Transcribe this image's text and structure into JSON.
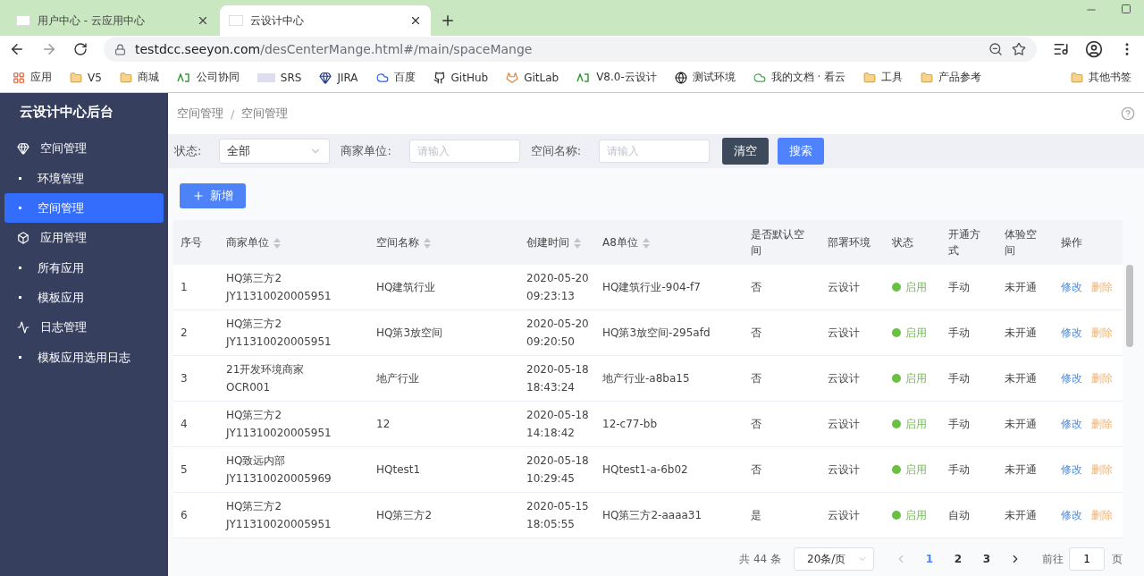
{
  "browser": {
    "tabs": [
      {
        "title": "用户中心 - 云应用中心",
        "selected": false
      },
      {
        "title": "云设计中心",
        "selected": true
      }
    ],
    "url": {
      "host": "testdcc.seeyon.com",
      "path": "/desCenterMange.html#/main/spaceMange"
    },
    "bookmarks": [
      "应用",
      "V5",
      "商城",
      "公司协同",
      "SRS",
      "JIRA",
      "百度",
      "GitHub",
      "GitLab",
      "V8.0-云设计",
      "测试环境",
      "我的文档 · 看云",
      "工具",
      "产品参考"
    ],
    "other_bookmarks": "其他书签"
  },
  "sidebar": {
    "title": "云设计中心后台",
    "sections": [
      {
        "label": "空间管理",
        "children": [
          {
            "label": "环境管理",
            "selected": false
          },
          {
            "label": "空间管理",
            "selected": true
          }
        ]
      },
      {
        "label": "应用管理",
        "children": [
          {
            "label": "所有应用",
            "selected": false
          },
          {
            "label": "模板应用",
            "selected": false
          }
        ]
      },
      {
        "label": "日志管理",
        "children": [
          {
            "label": "模板应用选用日志",
            "selected": false
          }
        ]
      }
    ]
  },
  "breadcrumb": {
    "items": [
      "空间管理",
      "空间管理"
    ],
    "separator": "/"
  },
  "filters": {
    "status": {
      "label": "状态:",
      "value": "全部"
    },
    "merchant": {
      "label": "商家单位:",
      "placeholder": "请输入"
    },
    "space_name": {
      "label": "空间名称:",
      "placeholder": "请输入"
    },
    "clear_button": "清空",
    "search_button": "搜索"
  },
  "add_button": "新增",
  "table": {
    "columns": [
      {
        "label": "序号",
        "sortable": false
      },
      {
        "label": "商家单位",
        "sortable": true
      },
      {
        "label": "空间名称",
        "sortable": true
      },
      {
        "label": "创建时间",
        "sortable": true
      },
      {
        "label": "A8单位",
        "sortable": true
      },
      {
        "label": "是否默认空间",
        "sortable": false
      },
      {
        "label": "部署环境",
        "sortable": false
      },
      {
        "label": "状态",
        "sortable": false
      },
      {
        "label": "开通方式",
        "sortable": false
      },
      {
        "label": "体验空间",
        "sortable": false
      },
      {
        "label": "操作",
        "sortable": false
      }
    ],
    "rows": [
      {
        "no": "1",
        "merchant": [
          "HQ第三方2",
          "JY11310020005951"
        ],
        "space": "HQ建筑行业",
        "created": [
          "2020-05-20",
          "09:23:13"
        ],
        "a8": "HQ建筑行业-904-f7",
        "default": "否",
        "env": "云设计",
        "status": {
          "text": "启用",
          "enabled": true
        },
        "open_mode": "手动",
        "trial": "未开通",
        "actions": [
          "修改",
          "删除"
        ]
      },
      {
        "no": "2",
        "merchant": [
          "HQ第三方2",
          "JY11310020005951"
        ],
        "space": "HQ第3放空间",
        "created": [
          "2020-05-20",
          "09:20:50"
        ],
        "a8": "HQ第3放空间-295afd",
        "default": "否",
        "env": "云设计",
        "status": {
          "text": "启用",
          "enabled": true
        },
        "open_mode": "手动",
        "trial": "未开通",
        "actions": [
          "修改",
          "删除"
        ]
      },
      {
        "no": "3",
        "merchant": [
          "21开发环境商家",
          "OCR001"
        ],
        "space": "地产行业",
        "created": [
          "2020-05-18",
          "18:43:24"
        ],
        "a8": "地产行业-a8ba15",
        "default": "否",
        "env": "云设计",
        "status": {
          "text": "启用",
          "enabled": true
        },
        "open_mode": "手动",
        "trial": "未开通",
        "actions": [
          "修改",
          "删除"
        ]
      },
      {
        "no": "4",
        "merchant": [
          "HQ第三方2",
          "JY11310020005951"
        ],
        "space": "12",
        "created": [
          "2020-05-18",
          "14:18:42"
        ],
        "a8": "12-c77-bb",
        "default": "否",
        "env": "云设计",
        "status": {
          "text": "启用",
          "enabled": true
        },
        "open_mode": "手动",
        "trial": "未开通",
        "actions": [
          "修改",
          "删除"
        ]
      },
      {
        "no": "5",
        "merchant": [
          "HQ致远内部",
          "JY11310020005969"
        ],
        "space": "HQtest1",
        "created": [
          "2020-05-18",
          "10:29:45"
        ],
        "a8": "HQtest1-a-6b02",
        "default": "否",
        "env": "云设计",
        "status": {
          "text": "启用",
          "enabled": true
        },
        "open_mode": "手动",
        "trial": "未开通",
        "actions": [
          "修改",
          "删除"
        ]
      },
      {
        "no": "6",
        "merchant": [
          "HQ第三方2",
          "JY11310020005951"
        ],
        "space": "HQ第三方2",
        "created": [
          "2020-05-15",
          "18:05:55"
        ],
        "a8": "HQ第三方2-aaaa31",
        "default": "是",
        "env": "云设计",
        "status": {
          "text": "启用",
          "enabled": true
        },
        "open_mode": "自动",
        "trial": "未开通",
        "actions": [
          "修改",
          "删除"
        ]
      }
    ]
  },
  "pagination": {
    "total": "共 44 条",
    "page_size": "20条/页",
    "pages": [
      {
        "label": "1",
        "selected": true
      },
      {
        "label": "2",
        "selected": false
      },
      {
        "label": "3",
        "selected": false
      }
    ],
    "goto_label": "前往",
    "goto_value": "1",
    "goto_suffix": "页"
  }
}
